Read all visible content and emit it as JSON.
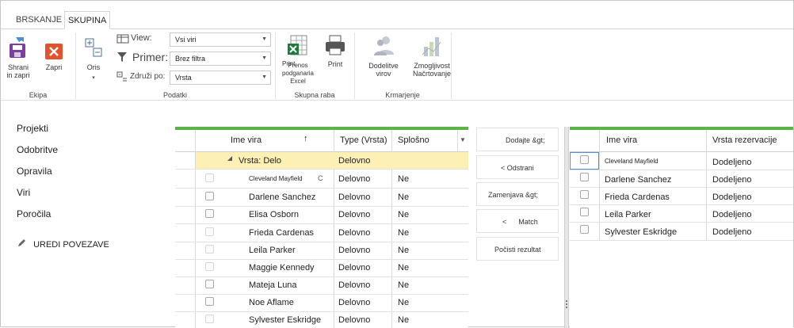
{
  "ribbon": {
    "tabs": [
      "BRSKANJE",
      "SKUPINA"
    ],
    "active_tab": "SKUPINA",
    "groups": {
      "ekipa": {
        "label": "Ekipa",
        "save_close_label": "Shrani in zapri",
        "close_label": "Zapri"
      },
      "podatki": {
        "label": "Podatki",
        "outline_label": "Oris",
        "view_label": "View:",
        "view_value": "Vsi viri",
        "filter_label": "Primer:",
        "filter_value": "Brez filtra",
        "group_label": "Združi po:",
        "group_value": "Vrsta"
      },
      "skupna_raba": {
        "label": "Skupna raba",
        "export_label": "Prenos podganaria Excel",
        "export_overlay": "Print",
        "print_label": "Print"
      },
      "krmarjenje": {
        "label": "Krmarjenje",
        "assignments_label": "Dodelitve virov",
        "planning_label": "Zmogljivost Načrtovanje"
      }
    }
  },
  "nav": {
    "items": [
      "Projekti",
      "Odobritve",
      "Opravila",
      "Viri",
      "Poročila"
    ],
    "edit_links": "UREDI POVEZAVE"
  },
  "left_grid": {
    "columns": [
      "Ime vira",
      "Type (Vrsta)",
      "Splošno"
    ],
    "sort_indicator": "↑",
    "group_row": {
      "label": "Vrsta: Delo",
      "type": "Delovno"
    },
    "rows": [
      {
        "name": "Cleveland Mayfield",
        "type": "Delovno",
        "general": "Ne",
        "small": true,
        "enabled": false,
        "extra": "C"
      },
      {
        "name": "Darlene Sanchez",
        "type": "Delovno",
        "general": "Ne",
        "small": false,
        "enabled": true
      },
      {
        "name": "Elisa Osborn",
        "type": "Delovno",
        "general": "Ne",
        "small": false,
        "enabled": true
      },
      {
        "name": "Frieda Cardenas",
        "type": "Delovno",
        "general": "Ne",
        "small": false,
        "enabled": false
      },
      {
        "name": "Leila Parker",
        "type": "Delovno",
        "general": "Ne",
        "small": false,
        "enabled": false
      },
      {
        "name": "Maggie Kennedy",
        "type": "Delovno",
        "general": "Ne",
        "small": false,
        "enabled": false
      },
      {
        "name": "Mateja Luna",
        "type": "Delovno",
        "general": "Ne",
        "small": false,
        "enabled": true
      },
      {
        "name": "Noe Aflame",
        "type": "Delovno",
        "general": "Ne",
        "small": false,
        "enabled": true
      },
      {
        "name": "Sylvester Eskridge",
        "type": "Delovno",
        "general": "Ne",
        "small": false,
        "enabled": false
      }
    ]
  },
  "middle_buttons": {
    "add": "Dodajte &gt;",
    "remove": "< Odstrani",
    "replace": "Zamenjava &gt;",
    "match": "<      Match",
    "clear": "Počisti rezultat"
  },
  "right_grid": {
    "columns": [
      "Ime vira",
      "Vrsta rezervacije"
    ],
    "rows": [
      {
        "name": "Cleveland Mayfield",
        "booking": "Dodeljeno",
        "small": true
      },
      {
        "name": "Darlene Sanchez",
        "booking": "Dodeljeno",
        "small": false
      },
      {
        "name": "Frieda Cardenas",
        "booking": "Dodeljeno",
        "small": false
      },
      {
        "name": "Leila Parker",
        "booking": "Dodeljeno",
        "small": false
      },
      {
        "name": "Sylvester Eskridge",
        "booking": "Dodeljeno",
        "small": false
      }
    ]
  },
  "colors": {
    "accent_green": "#5bb247",
    "group_row_bg": "#fdf0b5",
    "selected_row_border": "#4a90d9",
    "save_icon_purple": "#7b3fa0",
    "close_icon_red": "#e2532d"
  }
}
